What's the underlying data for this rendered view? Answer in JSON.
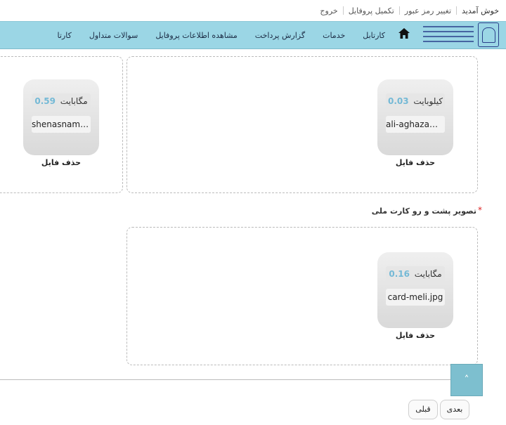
{
  "topbar": {
    "welcome": "خوش آمدید",
    "links": [
      "تغییر رمز عبور",
      "تکمیل پروفایل",
      "خروج"
    ]
  },
  "nav": {
    "items": [
      "کارتابل",
      "خدمات",
      "گزارش پرداخت",
      "مشاهده اطلاعات پروفایل",
      "سوالات متداول",
      "کارتا"
    ]
  },
  "upload_sections": [
    {
      "label": "",
      "files": [
        {
          "size_value": "0.03",
          "size_unit": "کیلوبایت",
          "filename": "ali-aghazamani.jpg",
          "remove_label": "حذف فایل"
        },
        {
          "size_value": "0.59",
          "size_unit": "مگابایت",
          "filename": "shenasname.jpg",
          "remove_label": "حذف فایل"
        }
      ]
    },
    {
      "label": "تصویر پشت و رو کارت ملی",
      "required_mark": "*",
      "files": [
        {
          "size_value": "0.16",
          "size_unit": "مگابایت",
          "filename": "card-meli.jpg",
          "remove_label": "حذف فایل"
        }
      ]
    }
  ],
  "buttons": {
    "next": "بعدی",
    "prev": "قبلی",
    "scroll_top": "˄"
  },
  "colors": {
    "nav_bg": "#9bd6e5",
    "size_accent": "#74b9d6",
    "scroll_top_bg": "#7dbfcf"
  }
}
